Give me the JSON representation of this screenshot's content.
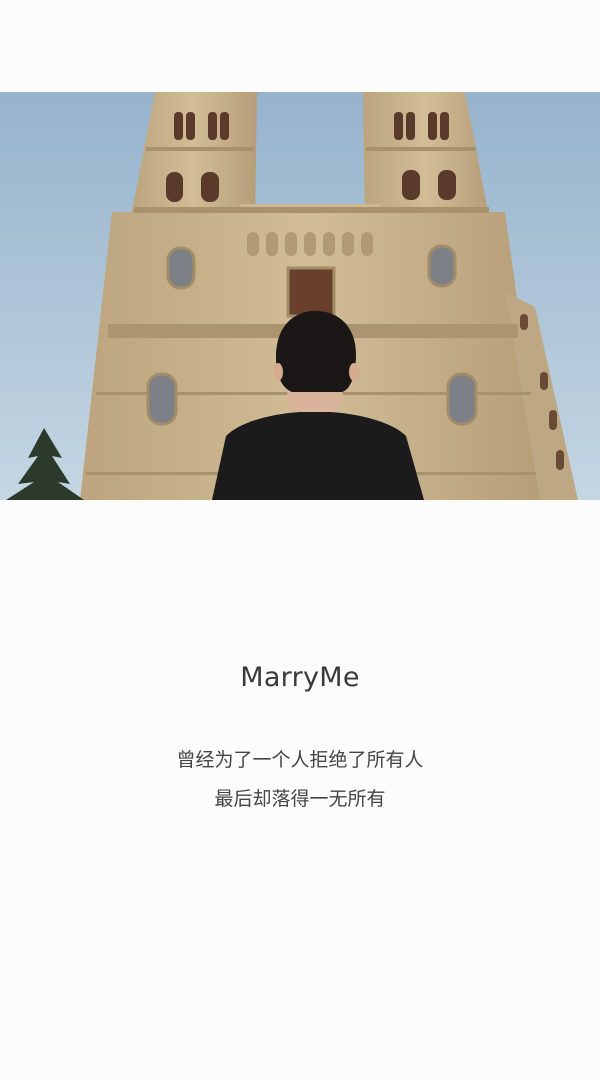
{
  "card": {
    "title": "MarryMe",
    "lines": [
      "曾经为了一个人拒绝了所有人",
      "最后却落得一无所有"
    ]
  },
  "colors": {
    "background": "#fcfcfc",
    "sky": "#a9c3d8",
    "building": "#c9b48e",
    "shirt": "#1b1b1b"
  }
}
